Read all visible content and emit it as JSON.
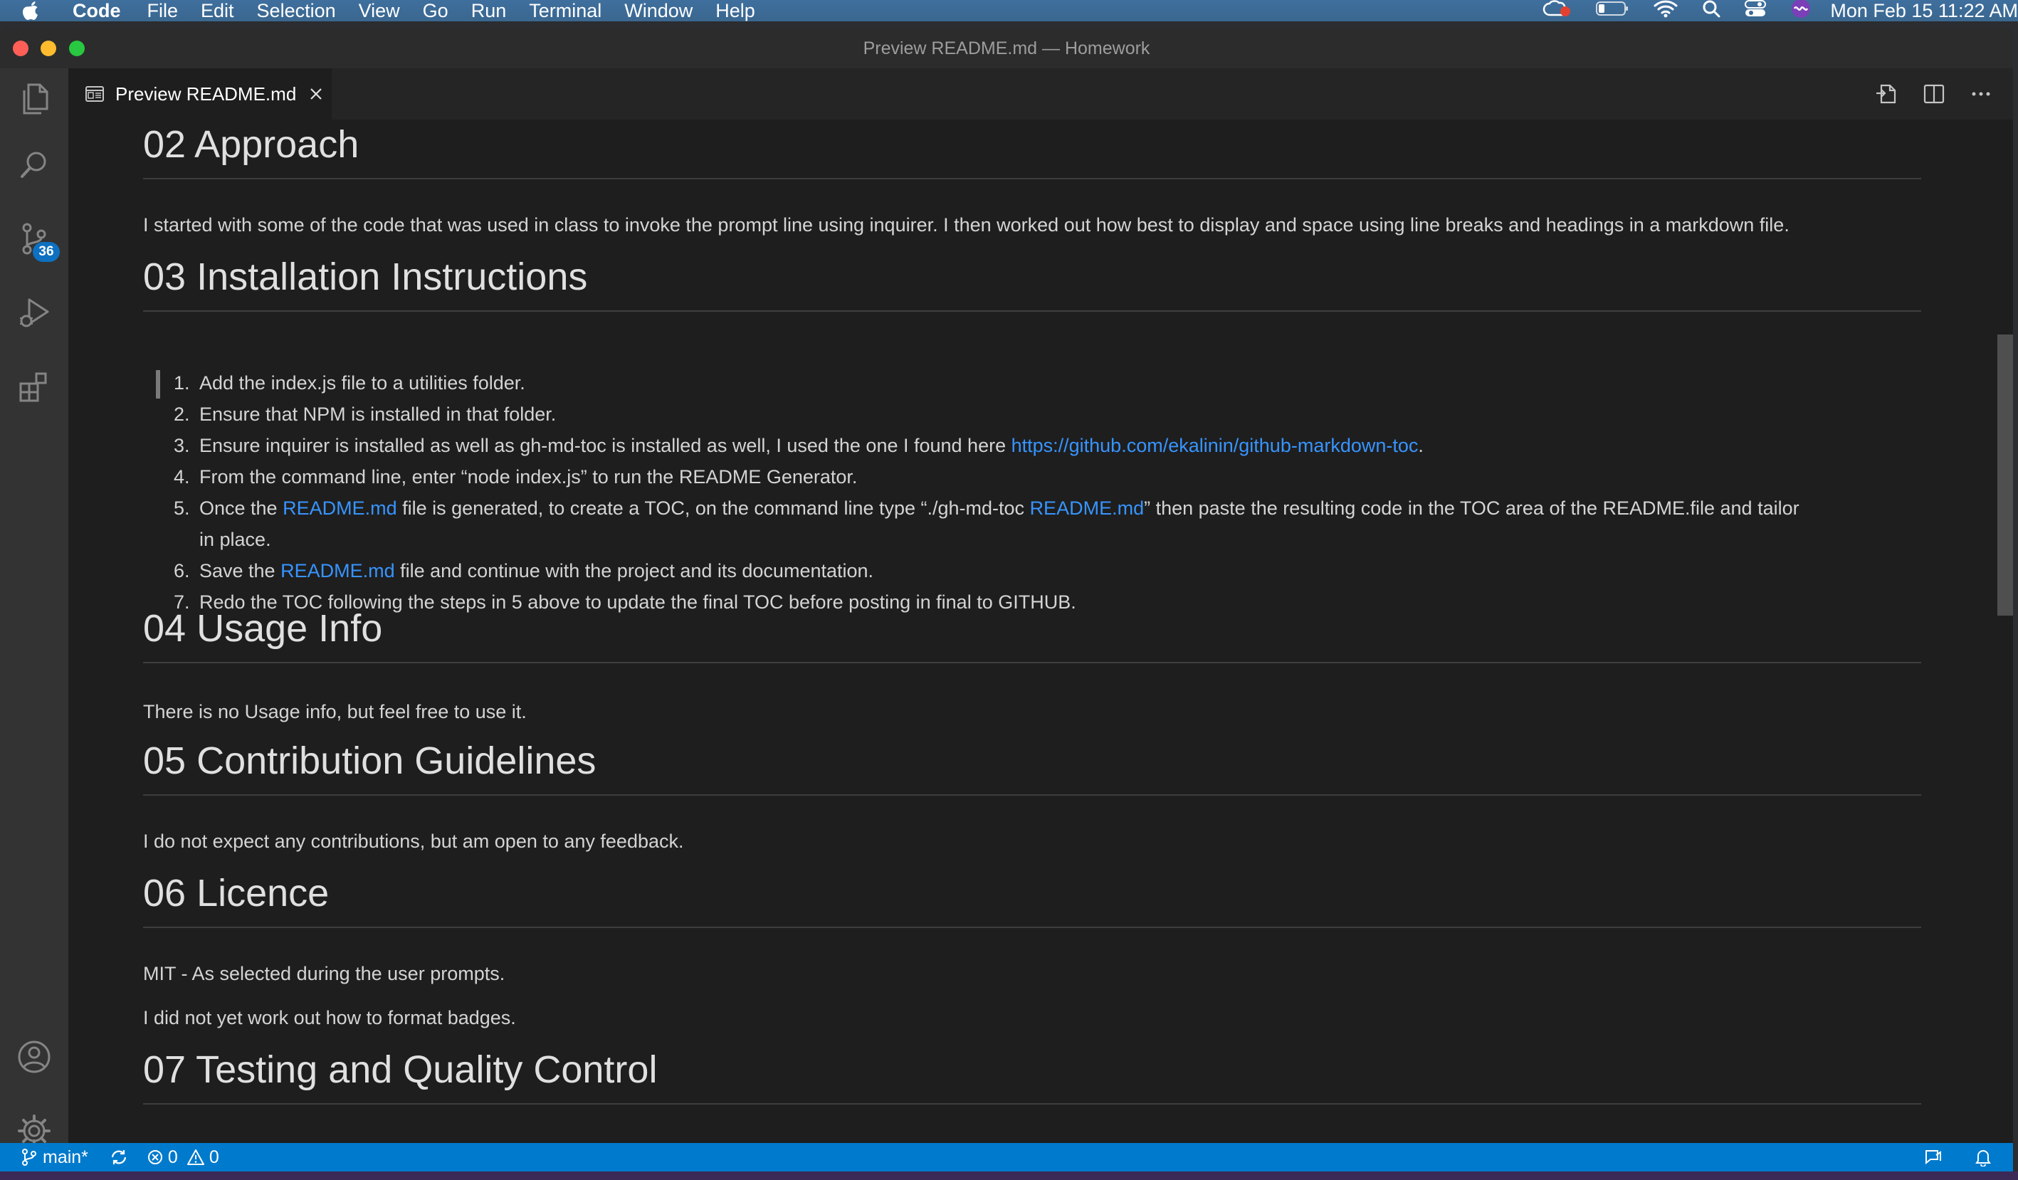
{
  "menubar": {
    "app": "Code",
    "menus": [
      "File",
      "Edit",
      "Selection",
      "View",
      "Go",
      "Run",
      "Terminal",
      "Window",
      "Help"
    ],
    "clock": "Mon Feb 15  11:22 AM"
  },
  "window": {
    "title": "Preview README.md — Homework"
  },
  "activitybar": {
    "scm_badge": "36"
  },
  "tab": {
    "label": "Preview README.md"
  },
  "document": {
    "sections": [
      {
        "heading": "02 Approach"
      },
      {
        "heading": "03 Installation Instructions"
      },
      {
        "heading": "04 Usage Info"
      },
      {
        "heading": "05 Contribution Guidelines"
      },
      {
        "heading": "06 Licence"
      },
      {
        "heading": "07 Testing and Quality Control"
      }
    ],
    "approach_text": "I started with some of the code that was used in class to invoke the prompt line using inquirer. I then worked out how best to display and space using line breaks and headings in a markdown file.",
    "install_steps": [
      {
        "num": "1.",
        "text": "Add the index.js file to a utilities folder."
      },
      {
        "num": "2.",
        "text": "Ensure that NPM is installed in that folder."
      },
      {
        "num": "3.",
        "pre": "Ensure inquirer is installed as well as gh-md-toc is installed as well, I used the one I found here ",
        "link": "https://github.com/ekalinin/github-markdown-toc",
        "post": "."
      },
      {
        "num": "4.",
        "text": "From the command line, enter “node index.js” to run the README Generator."
      },
      {
        "num": "5.",
        "pre": "Once the ",
        "link1": "README.md",
        "mid": " file is generated, to create a TOC, on the command line type “./gh-md-toc ",
        "link2": "README.md",
        "post": "” then paste the resulting code in the TOC area of the README.file and tailor",
        "cont": "in place."
      },
      {
        "num": "6.",
        "pre": "Save the ",
        "link": "README.md",
        "post": " file and continue with the project and its documentation."
      },
      {
        "num": "7.",
        "text": "Redo the TOC following the steps in 5 above to update the final TOC before posting in final to GITHUB."
      }
    ],
    "usage_text": "There is no Usage info, but feel free to use it.",
    "contribution_text": "I do not expect any contributions, but am open to any feedback.",
    "licence_text1": "MIT - As selected during the user prompts.",
    "licence_text2": "I did not yet work out how to format badges."
  },
  "statusbar": {
    "branch": "main*",
    "errors": "0",
    "warnings": "0"
  }
}
